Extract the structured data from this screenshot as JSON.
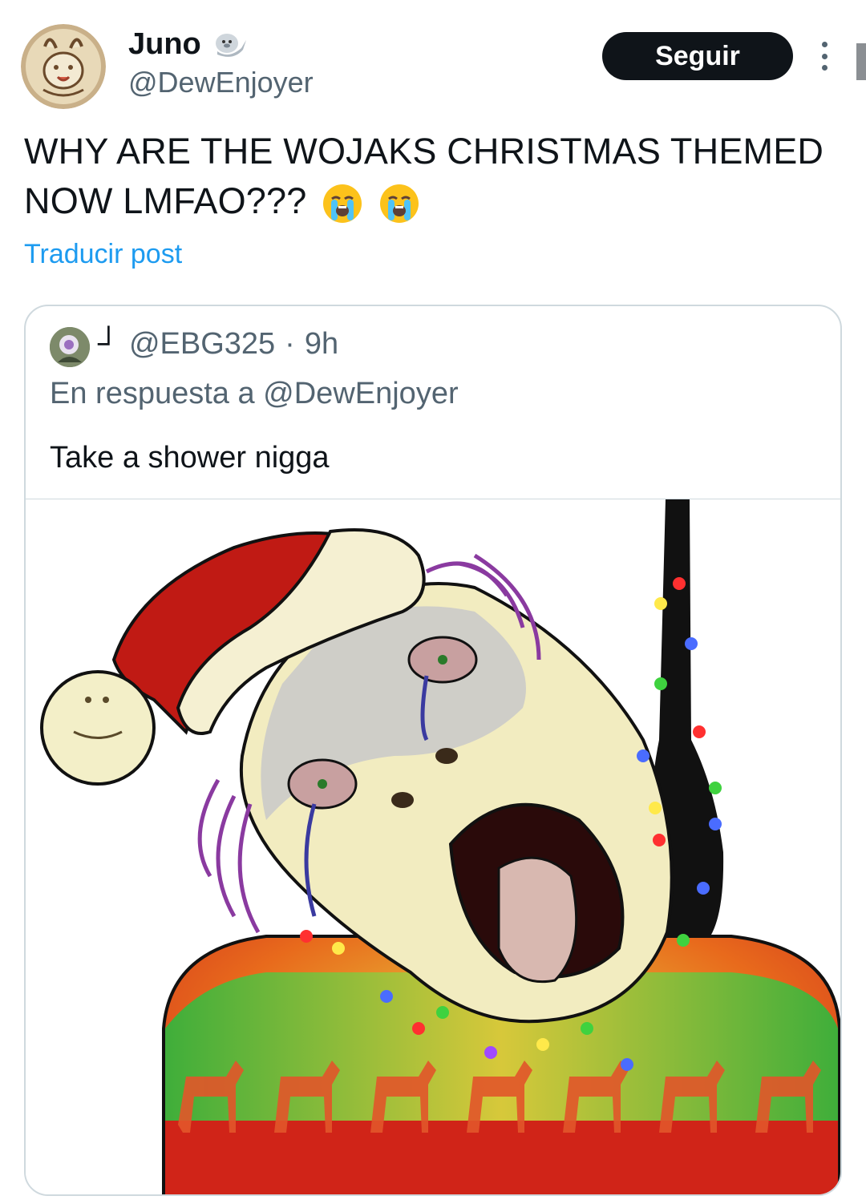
{
  "author": {
    "display_name": "Juno",
    "handle": "@DewEnjoyer",
    "badge_icon": "seal-icon"
  },
  "actions": {
    "follow_label": "Seguir",
    "more_icon": "more-vertical-icon"
  },
  "post": {
    "text": "WHY ARE THE WOJAKS CHRISTMAS THEMED NOW LMFAO???",
    "emojis": [
      "loudly-crying-face",
      "loudly-crying-face"
    ],
    "translate_label": "Traducir post"
  },
  "quoted_post": {
    "display_name": "┘",
    "handle": "@EBG325",
    "separator": "·",
    "time": "9h",
    "reply_context": "En respuesta a @DewEnjoyer",
    "text": "Take a shower nigga",
    "media": "christmas-wojak-image"
  },
  "colors": {
    "link": "#1d9bf0",
    "text_primary": "#0f1419",
    "text_secondary": "#536471",
    "border": "#cfd9de",
    "button_bg": "#0f1419"
  }
}
